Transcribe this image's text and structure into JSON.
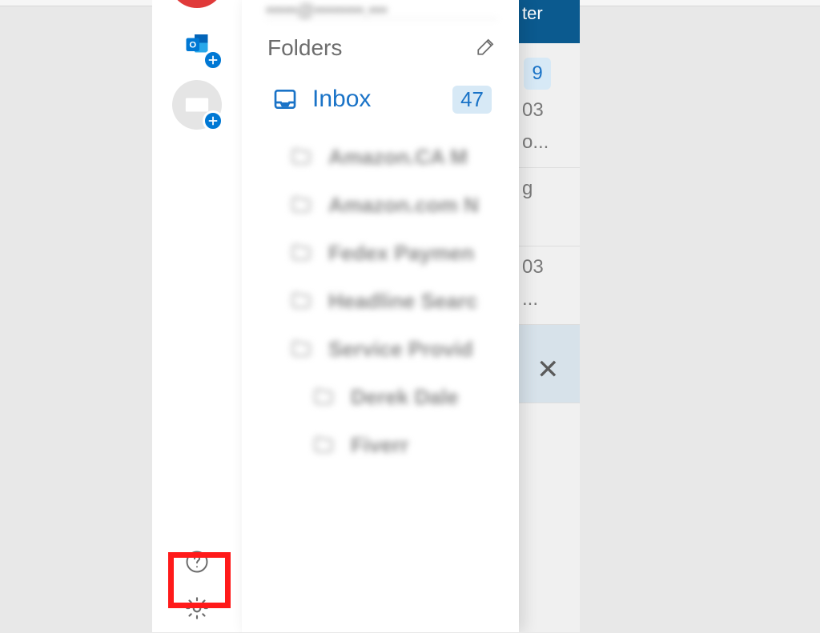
{
  "rail": {
    "accounts": [
      {
        "id": "primary",
        "color": "red"
      },
      {
        "id": "outlook",
        "has_plus": true
      },
      {
        "id": "mail",
        "has_plus": true
      }
    ]
  },
  "panel": {
    "email_header": "•••••@••••••••.•••",
    "folders_heading": "Folders",
    "inbox": {
      "label": "Inbox",
      "count": "47"
    },
    "folders": [
      {
        "label": "Amazon.CA M",
        "indent": 1
      },
      {
        "label": "Amazon.com N",
        "indent": 1
      },
      {
        "label": "Fedex Paymen",
        "indent": 1
      },
      {
        "label": "Headline Searc",
        "indent": 1
      },
      {
        "label": "Service Provid",
        "indent": 1
      },
      {
        "label": "Derek Dale",
        "indent": 2
      },
      {
        "label": "Fiverr",
        "indent": 2
      }
    ]
  },
  "bg": {
    "tab_label": "ter",
    "badge_count": "9",
    "rows": [
      {
        "line1": "03",
        "line2": "o..."
      },
      {
        "line1": "g",
        "line2": ""
      },
      {
        "line1": "03",
        "line2": "..."
      }
    ]
  }
}
